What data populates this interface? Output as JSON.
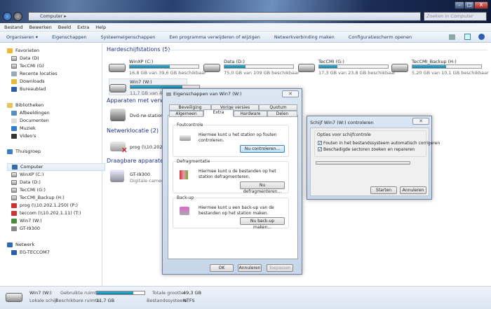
{
  "window": {
    "breadcrumb": "Computer",
    "search_placeholder": "Zoeken in Computer",
    "minimize": "–",
    "maximize": "□",
    "close": "X"
  },
  "menu": [
    "Bestand",
    "Bewerken",
    "Beeld",
    "Extra",
    "Help"
  ],
  "toolbar": [
    "Organiseren ▾",
    "Eigenschappen",
    "Systeemeigenschappen",
    "Een programma verwijderen of wijzigen",
    "Netwerkverbinding maken",
    "Configuratiescherm openen"
  ],
  "nav": {
    "favorites": {
      "label": "Favorieten",
      "items": [
        "Data (D)",
        "TecCMI (G)",
        "Recente locaties",
        "Downloads",
        "Bureaublad"
      ]
    },
    "libraries": {
      "label": "Bibliotheken",
      "items": [
        "Afbeeldingen",
        "Documenten",
        "Muziek",
        "Video's"
      ]
    },
    "homegroup": "Thuisgroep",
    "computer": {
      "label": "Computer",
      "items": [
        "WinXP (C:)",
        "Data (D:)",
        "TecCMI (G:)",
        "TecCMI_Backup (H:)",
        "prog (\\\\10.202.1.250) (P:)",
        "teccom (\\\\10.202.1.11) (T:)",
        "Win7 (W:)",
        "GT-I9300"
      ]
    },
    "network": {
      "label": "Netwerk",
      "items": [
        "EG-TECCOM7"
      ]
    }
  },
  "groups": {
    "hdd": "Hardeschijfstations (5)",
    "devices": "Apparaten met verw",
    "network": "Netwerklocatie (2)",
    "portable": "Draagbare apparaten"
  },
  "drives": [
    {
      "name": "WinXP (C:)",
      "info": "16,8 GB van 39,6 GB beschikbaar",
      "used": 0.58
    },
    {
      "name": "Data (D:)",
      "info": "75,0 GB van 109 GB beschikbaar",
      "used": 0.31
    },
    {
      "name": "TecCMI (G:)",
      "info": "17,3 GB van 23,8 GB beschikbaar",
      "used": 0.27
    },
    {
      "name": "TecCMI_Backup (H:)",
      "info": "5,20 GB van 10,1 GB beschikbaar",
      "used": 0.49
    },
    {
      "name": "Win7 (W:)",
      "info": "11,7 GB van 49,3 GB beschikbaar",
      "used": 0.76
    }
  ],
  "dvd": "Dvd-rw-station (",
  "netloc": "prog (\\\\10.202.1.",
  "portable": {
    "name": "GT-I9300",
    "type": "Digitale camera"
  },
  "props": {
    "title": "Eigenschappen van Win7 (W:)",
    "tabs_back": [
      "Beveiliging",
      "Vorige versies",
      "Quotum"
    ],
    "tabs_front": [
      "Algemeen",
      "Extra",
      "Hardware",
      "Delen"
    ],
    "sections": [
      {
        "legend": "Foutcontrole",
        "text": "Hiermee kunt u het station op fouten controleren.",
        "button": "Nu controleren..."
      },
      {
        "legend": "Defragmentatie",
        "text": "Hiermee kunt u de bestanden op het station defragmenteren.",
        "button": "Nu defragmenteren..."
      },
      {
        "legend": "Back-up",
        "text": "Hiermee kunt u een back-up van de bestanden op het station maken.",
        "button": "Nu back-up maken..."
      }
    ],
    "ok": "OK",
    "cancel": "Annuleren",
    "apply": "Toepassen"
  },
  "check": {
    "title": "Schijf Win7 (W:) controleren",
    "legend": "Opties voor schijfcontrole",
    "opt1": "Fouten in het bestandssysteem automatisch corrigeren",
    "opt2": "Beschadigde sectoren zoeken en repareren",
    "progress": 0,
    "start": "Starten",
    "cancel": "Annuleren"
  },
  "status": {
    "name": "Win7 (W:)",
    "type": "Lokale schijf",
    "used_label": "Gebruikte ruimte:",
    "free_label": "Beschikbare ruimte:",
    "free": "11,7 GB",
    "total_label": "Totale grootte:",
    "total": "49,3 GB",
    "fs_label": "Bestandssysteem:",
    "fs": "NTFS",
    "used": 0.76
  }
}
